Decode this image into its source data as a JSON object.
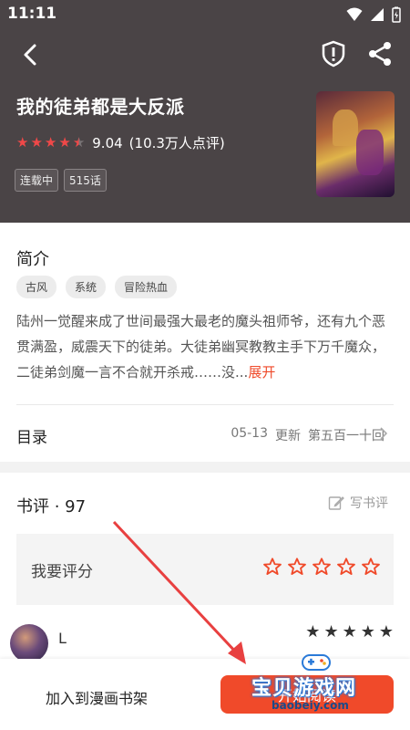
{
  "status_bar": {
    "time": "11:11"
  },
  "header": {
    "title": "我的徒弟都是大反派",
    "rating_score": "9.04",
    "rating_count": "(10.3万人点评)",
    "rating_stars": 4.5,
    "badges": [
      "连载中",
      "515话"
    ]
  },
  "intro": {
    "heading": "简介",
    "tags": [
      "古风",
      "系统",
      "冒险热血"
    ],
    "description": "陆州一觉醒来成了世间最强大最老的魔头祖师爷，还有九个恶贯满盈，威震天下的徒弟。大徒弟幽冥教教主手下万千魔众，二徒弟剑魔一言不合就开杀戒……没...",
    "expand": "展开"
  },
  "toc": {
    "label": "目录",
    "date": "05-13",
    "update": "更新",
    "chapter": "第五百一十回"
  },
  "reviews": {
    "heading": "书评 · 97",
    "write": "写书评",
    "rate_prompt": "我要评分",
    "user": {
      "name": "L",
      "stars": 5
    }
  },
  "bottom_bar": {
    "add_shelf": "加入到漫画书架",
    "read": "开始阅读"
  },
  "watermark": {
    "text": "宝贝游戏网",
    "url": "baobeiy.com"
  },
  "colors": {
    "accent": "#f04a2a",
    "header_bg": "#4a4446",
    "star": "#f04848"
  }
}
